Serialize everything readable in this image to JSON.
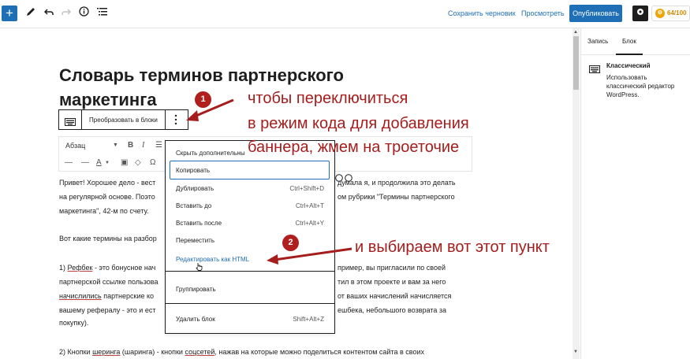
{
  "topbar": {
    "save_draft": "Сохранить черновик",
    "preview": "Просмотреть",
    "publish": "Опубликовать",
    "score": "64/100"
  },
  "sidebar": {
    "tab_post": "Запись",
    "tab_block": "Блок",
    "block_name": "Классический",
    "block_desc": "Использовать классический редактор WordPress."
  },
  "post": {
    "title": "Словарь терминов партнерского маркетинга",
    "lines": [
      {
        "pre": "Привет! Хорошее дело - вест",
        "post": "думала я, и продолжила это делать"
      },
      {
        "pre": "на регулярной основе. Поэто",
        "post": "ом рубрики \"Термины партнерского"
      },
      {
        "pre": "маркетинга\", 42-м по счету.",
        "post": ""
      },
      {
        "pre": "Вот какие термины на разбор",
        "post": ""
      },
      {
        "pre": "1) ",
        "link": "Рефбек",
        "mid": " - это бонусное нач",
        "post": "пример, вы пригласили по своей"
      },
      {
        "pre": "партнерской ссылке пользова",
        "post": "тил в этом проекте и вам за него"
      },
      {
        "pre": "",
        "link": "начислились",
        "mid": " партнерские ко",
        "post": "от ваших начислений начисляется"
      },
      {
        "pre": "вашему рефералу - это и ест",
        "post": "ешбека, небольшого возврата за"
      },
      {
        "pre": "покупку).",
        "post": ""
      },
      {
        "pre": "2) Кнопки ",
        "link": "шеринга",
        "mid": " (шаринга) - кнопки ",
        "link2": "соцсетей",
        "post": ", нажав на которые можно поделиться контентом сайта в своих"
      }
    ]
  },
  "block_toolbar": {
    "convert_label": "Преобразовать в блоки"
  },
  "classic_toolbar": {
    "format_select": "Абзац"
  },
  "menu": {
    "items": [
      {
        "label": "Скрыть дополнительны",
        "shortcut": ""
      },
      {
        "label": "Копировать",
        "shortcut": ""
      },
      {
        "label": "Дублировать",
        "shortcut": "Ctrl+Shift+D"
      },
      {
        "label": "Вставить до",
        "shortcut": "Ctrl+Alt+T"
      },
      {
        "label": "Вставить после",
        "shortcut": "Ctrl+Alt+Y"
      },
      {
        "label": "Переместить",
        "shortcut": ""
      },
      {
        "label": "Редактировать как HTML",
        "shortcut": ""
      },
      {
        "label": "Группировать",
        "shortcut": ""
      },
      {
        "label": "Удалить блок",
        "shortcut": "Shift+Alt+Z"
      }
    ]
  },
  "annotations": {
    "badge1": "1",
    "badge2": "2",
    "text1_line1": "чтобы переключиться",
    "text1_line2": "в режим кода для добавления",
    "text1_line3": "баннера, жмем на троеточие",
    "text2": "и выбираем вот этот пункт"
  },
  "colors": {
    "accent": "#1e6fb5",
    "annotation": "#a51d1d"
  }
}
